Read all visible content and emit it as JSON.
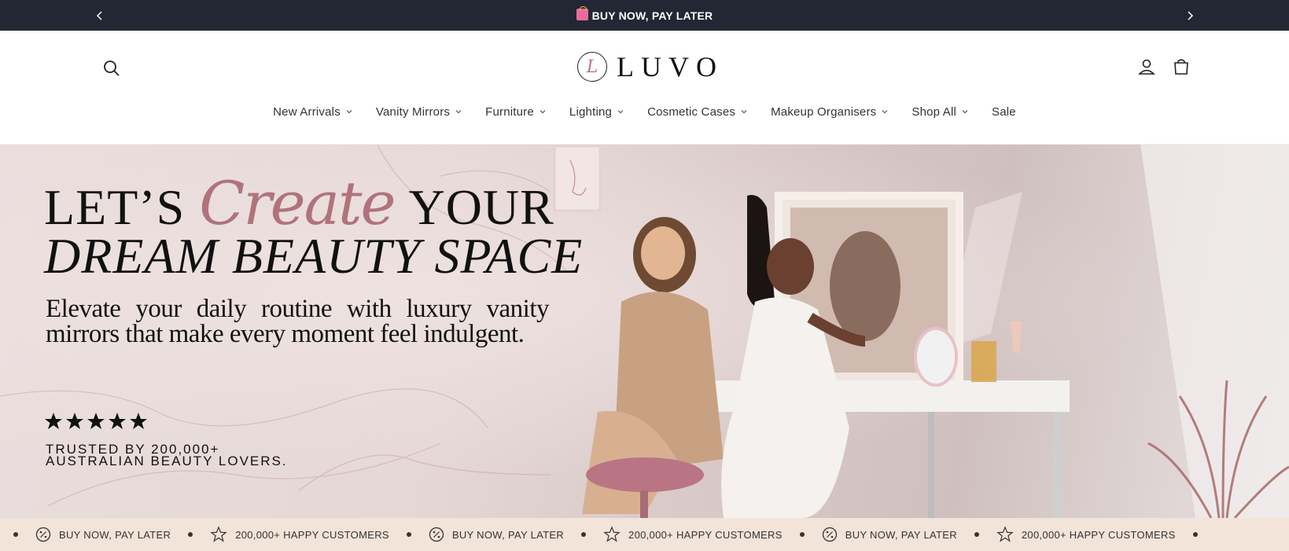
{
  "announcement": {
    "text": "BUY NOW, PAY LATER",
    "prev_icon": "chevron-left-icon",
    "next_icon": "chevron-right-icon"
  },
  "header": {
    "logo_mark": "L",
    "logo_text": "LUVO",
    "icons": [
      "search-icon",
      "account-icon",
      "cart-icon"
    ]
  },
  "nav": {
    "items": [
      {
        "label": "New Arrivals",
        "dropdown": true
      },
      {
        "label": "Vanity Mirrors",
        "dropdown": true
      },
      {
        "label": "Furniture",
        "dropdown": true
      },
      {
        "label": "Lighting",
        "dropdown": true
      },
      {
        "label": "Cosmetic Cases",
        "dropdown": true
      },
      {
        "label": "Makeup Organisers",
        "dropdown": true
      },
      {
        "label": "Shop All",
        "dropdown": true
      },
      {
        "label": "Sale",
        "dropdown": false
      }
    ]
  },
  "hero": {
    "line1_a": "LET’S",
    "line1_script": "Create",
    "line1_b": "YOUR",
    "line2": "DREAM BEAUTY SPACE",
    "subtitle": "Elevate your daily routine with luxury vanity mirrors that make every moment feel indulgent.",
    "rating_stars": 5,
    "trust_text": "TRUSTED BY 200,000+\nAUSTRALIAN BEAUTY LOVERS.",
    "accent_color": "#b0737c"
  },
  "marquee": {
    "items": [
      {
        "icon": "percent-icon",
        "label": "BUY NOW, PAY LATER"
      },
      {
        "icon": "star-outline-icon",
        "label": "200,000+ HAPPY CUSTOMERS"
      },
      {
        "icon": "percent-icon",
        "label": "BUY NOW, PAY LATER"
      },
      {
        "icon": "star-outline-icon",
        "label": "200,000+ HAPPY CUSTOMERS"
      },
      {
        "icon": "percent-icon",
        "label": "BUY NOW, PAY LATER"
      },
      {
        "icon": "star-outline-icon",
        "label": "200,000+ HAPPY CUSTOMERS"
      }
    ]
  },
  "colors": {
    "announcement_bg": "#222733",
    "marquee_bg": "#f3e4d9"
  }
}
